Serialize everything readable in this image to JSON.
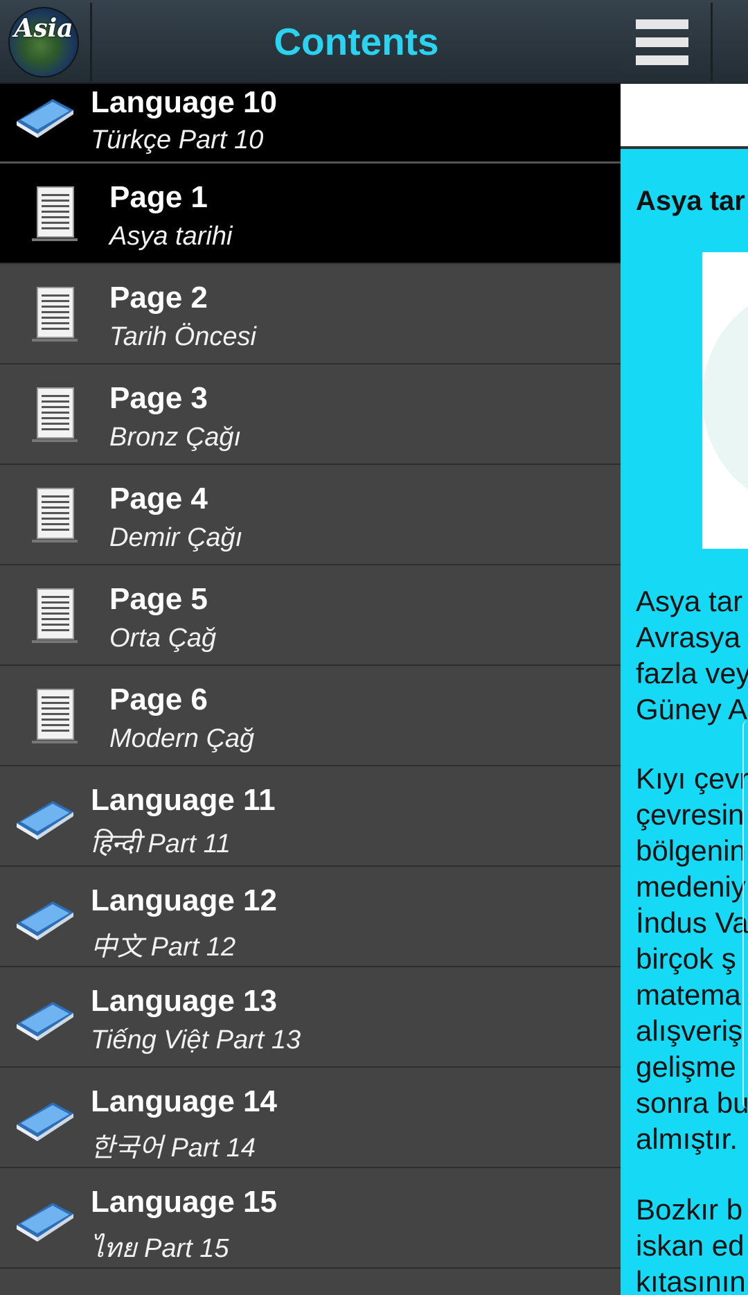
{
  "drawer": {
    "logo_text": "Asia",
    "title": "Contents",
    "items": [
      {
        "kind": "lang",
        "title": "Language 10",
        "subtitle": "Türkçe Part 10"
      },
      {
        "kind": "page",
        "title": "Page 1",
        "subtitle": "Asya tarihi",
        "active": true
      },
      {
        "kind": "page",
        "title": "Page 2",
        "subtitle": "Tarih Öncesi"
      },
      {
        "kind": "page",
        "title": "Page 3",
        "subtitle": "Bronz Çağı"
      },
      {
        "kind": "page",
        "title": "Page 4",
        "subtitle": "Demir Çağı"
      },
      {
        "kind": "page",
        "title": "Page 5",
        "subtitle": "Orta Çağ"
      },
      {
        "kind": "page",
        "title": "Page 6",
        "subtitle": "Modern Çağ"
      },
      {
        "kind": "lang",
        "title": "Language 11",
        "subtitle": "हिन्दी Part 11"
      },
      {
        "kind": "lang",
        "title": "Language 12",
        "subtitle": "中文 Part 12"
      },
      {
        "kind": "lang",
        "title": "Language 13",
        "subtitle": "Tiếng Việt Part 13"
      },
      {
        "kind": "lang",
        "title": "Language 14",
        "subtitle": "한국어 Part 14"
      },
      {
        "kind": "lang",
        "title": "Language 15",
        "subtitle": "ไทย Part 15"
      }
    ]
  },
  "content": {
    "article_title": "Asya tar",
    "paragraphs": [
      [
        "Asya tar",
        "Avrasya",
        "fazla vey",
        "Güney A"
      ],
      [
        "Kıyı çevr",
        "çevresin",
        "bölgenin",
        "medeniy",
        "İndus Va",
        "birçok ş",
        "matema",
        "alışveriş",
        "gelişme",
        "sonra bu",
        "almıştır."
      ],
      [
        "Bozkır b",
        "iskan ed",
        "kıtasının"
      ]
    ]
  },
  "colors": {
    "accent": "#2ad3f0",
    "content_bg": "#15d9f5",
    "drawer_bg": "#444444",
    "active_row": "#000000"
  }
}
